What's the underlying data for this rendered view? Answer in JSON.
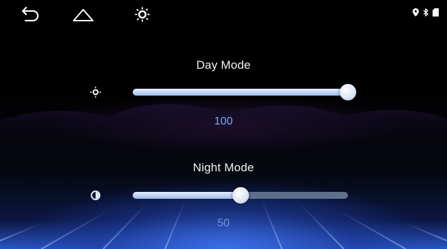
{
  "status_bar": {
    "nav_icons": [
      "back-icon",
      "home-icon",
      "brightness-icon"
    ],
    "status_icons": [
      "location-icon",
      "bluetooth-icon",
      "battery-icon"
    ]
  },
  "day_mode": {
    "title": "Day Mode",
    "value": "100",
    "level": 1.0,
    "icon": "sun-icon"
  },
  "night_mode": {
    "title": "Night Mode",
    "value": "50",
    "level": 0.5,
    "icon": "half-moon-brightness-icon"
  },
  "colors": {
    "slider_track": "#5e6f8c",
    "slider_fill": "#c8d8f6",
    "value_text": "#7aaaf2",
    "background_glow": "#2a56c8"
  }
}
